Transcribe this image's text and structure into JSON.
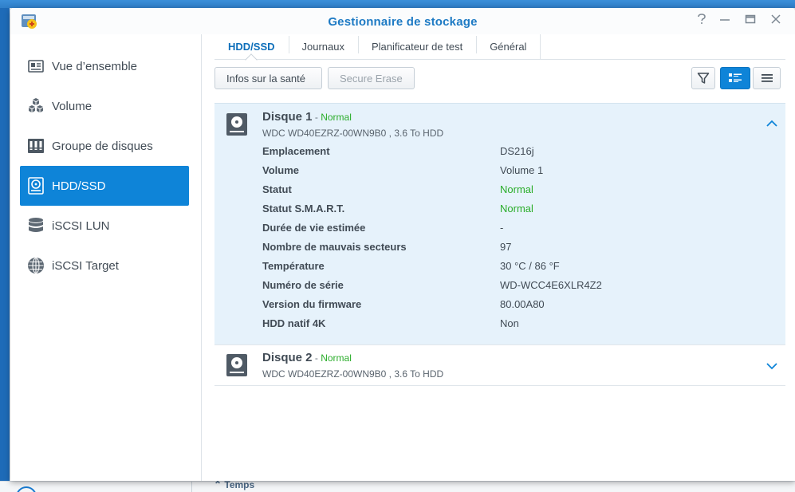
{
  "window": {
    "title": "Gestionnaire de stockage",
    "help": "?",
    "minimize": "—",
    "maximize": "▭",
    "close": "✕"
  },
  "sidebar": {
    "items": [
      {
        "label": "Vue d’ensemble",
        "icon": "overview-icon"
      },
      {
        "label": "Volume",
        "icon": "volume-cubes-icon"
      },
      {
        "label": "Groupe de disques",
        "icon": "disk-group-icon"
      },
      {
        "label": "HDD/SSD",
        "icon": "hdd-icon",
        "active": true
      },
      {
        "label": "iSCSI LUN",
        "icon": "database-icon"
      },
      {
        "label": "iSCSI Target",
        "icon": "globe-icon"
      }
    ]
  },
  "tabs": [
    {
      "label": "HDD/SSD",
      "active": true
    },
    {
      "label": "Journaux"
    },
    {
      "label": "Planificateur de test"
    },
    {
      "label": "Général"
    }
  ],
  "toolbar": {
    "health_label": "Infos sur la santé",
    "secure_erase_label": "Secure Erase"
  },
  "disks": [
    {
      "name": "Disque 1",
      "dash": " - ",
      "status": "Normal",
      "model": "WDC WD40EZRZ-00WN9B0 , 3.6 To HDD",
      "expanded": true,
      "details": [
        {
          "key": "Emplacement",
          "value": "DS216j"
        },
        {
          "key": "Volume",
          "value": "Volume 1"
        },
        {
          "key": "Statut",
          "value": "Normal",
          "ok": true
        },
        {
          "key": "Statut S.M.A.R.T.",
          "value": "Normal",
          "ok": true
        },
        {
          "key": "Durée de vie estimée",
          "value": "-"
        },
        {
          "key": "Nombre de mauvais secteurs",
          "value": "97"
        },
        {
          "key": "Température",
          "value": "30 °C / 86 °F"
        },
        {
          "key": "Numéro de série",
          "value": "WD-WCC4E6XLR4Z2"
        },
        {
          "key": "Version du firmware",
          "value": "80.00A80"
        },
        {
          "key": "HDD natif 4K",
          "value": "Non"
        }
      ]
    },
    {
      "name": "Disque 2",
      "dash": " - ",
      "status": "Normal",
      "model": "WDC WD40EZRZ-00WN9B0 , 3.6 To HDD",
      "expanded": false
    }
  ],
  "background": {
    "partial_text": "Temps"
  },
  "colors": {
    "accent": "#0e84d8",
    "title": "#1d7ac4",
    "ok": "#2bad2b",
    "expanded_bg": "#e6f2fb"
  }
}
